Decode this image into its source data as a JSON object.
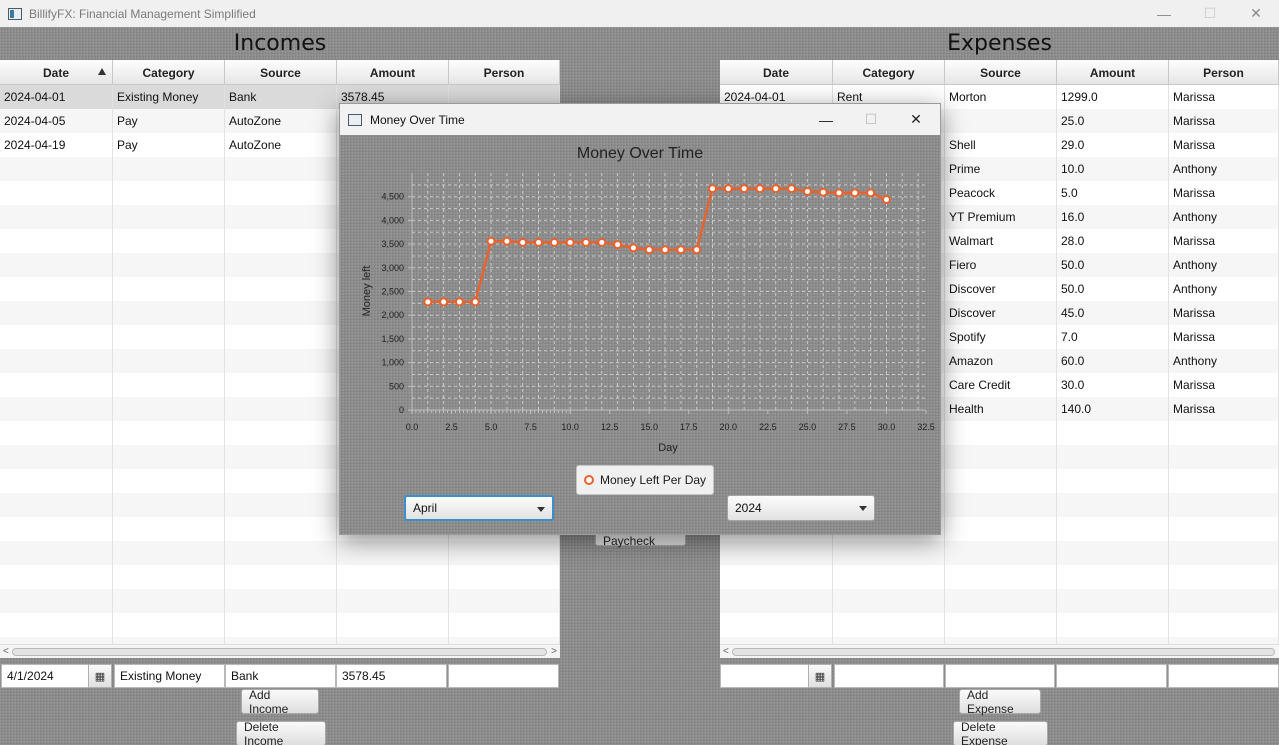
{
  "app": {
    "title": "BillifyFX: Financial Management Simplified",
    "window_controls": {
      "minimize": "—",
      "maximize": "☐",
      "close": "✕"
    }
  },
  "incomes": {
    "title": "Incomes",
    "columns": [
      "Date",
      "Category",
      "Source",
      "Amount",
      "Person"
    ],
    "rows": [
      [
        "2024-04-01",
        "Existing Money",
        "Bank",
        "3578.45",
        ""
      ],
      [
        "2024-04-05",
        "Pay",
        "AutoZone",
        "",
        ""
      ],
      [
        "2024-04-19",
        "Pay",
        "AutoZone",
        "",
        ""
      ]
    ],
    "form": {
      "date": "4/1/2024",
      "category": "Existing Money",
      "source": "Bank",
      "amount": "3578.45",
      "person": ""
    },
    "add_label": "Add Income",
    "delete_label": "Delete Income"
  },
  "expenses": {
    "title": "Expenses",
    "columns": [
      "Date",
      "Category",
      "Source",
      "Amount",
      "Person"
    ],
    "rows": [
      [
        "2024-04-01",
        "Rent",
        "Morton",
        "1299.0",
        "Marissa"
      ],
      [
        "",
        "",
        "",
        "25.0",
        "Marissa"
      ],
      [
        "",
        "",
        "Shell",
        "29.0",
        "Marissa"
      ],
      [
        "",
        "",
        "Prime",
        "10.0",
        "Anthony"
      ],
      [
        "",
        "",
        "Peacock",
        "5.0",
        "Marissa"
      ],
      [
        "",
        "",
        "YT Premium",
        "16.0",
        "Anthony"
      ],
      [
        "",
        "",
        "Walmart",
        "28.0",
        "Marissa"
      ],
      [
        "",
        "",
        "Fiero",
        "50.0",
        "Anthony"
      ],
      [
        "",
        "",
        "Discover",
        "50.0",
        "Anthony"
      ],
      [
        "",
        "",
        "Discover",
        "45.0",
        "Marissa"
      ],
      [
        "",
        "",
        "Spotify",
        "7.0",
        "Marissa"
      ],
      [
        "",
        "",
        "Amazon",
        "60.0",
        "Anthony"
      ],
      [
        "",
        "",
        "Care Credit",
        "30.0",
        "Marissa"
      ],
      [
        "",
        "",
        "Health",
        "140.0",
        "Marissa"
      ]
    ],
    "add_label": "Add Expense",
    "delete_label": "Delete Expense"
  },
  "middle": {
    "add_paycheck_label": "Add Paycheck"
  },
  "dialog": {
    "title": "Money Over Time",
    "month_selected": "April",
    "year_selected": "2024"
  },
  "chart_data": {
    "type": "line",
    "title": "Money Over Time",
    "xlabel": "Day",
    "ylabel": "Money left",
    "xlim": [
      0,
      32.5
    ],
    "ylim": [
      0,
      5000
    ],
    "x_ticks": [
      "0.0",
      "2.5",
      "5.0",
      "7.5",
      "10.0",
      "12.5",
      "15.0",
      "17.5",
      "20.0",
      "22.5",
      "25.0",
      "27.5",
      "30.0",
      "32.5"
    ],
    "y_ticks": [
      "0",
      "500",
      "1,000",
      "1,500",
      "2,000",
      "2,500",
      "3,000",
      "3,500",
      "4,000",
      "4,500"
    ],
    "grid": true,
    "legend_position": "bottom",
    "series": [
      {
        "name": "Money Left Per Day",
        "color": "#e8622e",
        "x": [
          1,
          2,
          3,
          4,
          5,
          6,
          7,
          8,
          9,
          10,
          11,
          12,
          13,
          14,
          15,
          16,
          17,
          18,
          19,
          20,
          21,
          22,
          23,
          24,
          25,
          26,
          27,
          28,
          29,
          30
        ],
        "y": [
          2280,
          2280,
          2280,
          2280,
          3560,
          3560,
          3535,
          3535,
          3535,
          3535,
          3535,
          3535,
          3490,
          3420,
          3380,
          3380,
          3380,
          3380,
          4670,
          4670,
          4670,
          4670,
          4670,
          4670,
          4610,
          4595,
          4580,
          4580,
          4580,
          4440
        ]
      }
    ]
  }
}
